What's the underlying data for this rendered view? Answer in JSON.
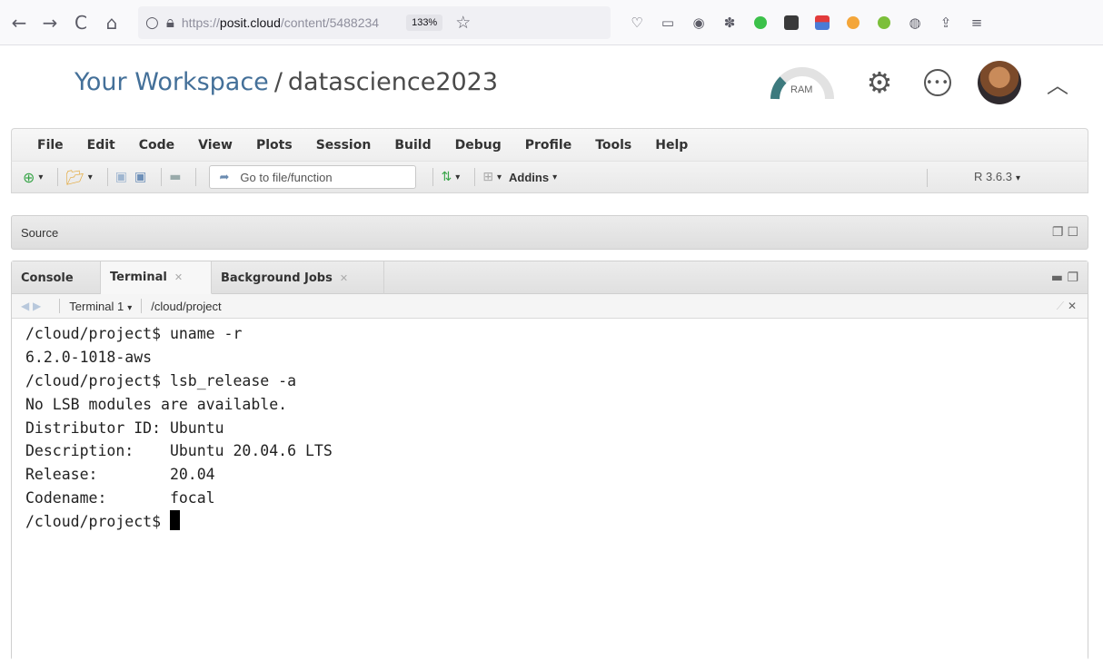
{
  "browser": {
    "back": "←",
    "forward": "→",
    "reload": "C",
    "home": "⌂",
    "url_prefix": "https://",
    "url_host": "posit.cloud",
    "url_path": "/content/5488234",
    "zoom": "133%"
  },
  "header": {
    "workspace_link": "Your Workspace",
    "separator": "/",
    "project_name": "datascience2023",
    "ram_label": "RAM"
  },
  "menu": [
    "File",
    "Edit",
    "Code",
    "View",
    "Plots",
    "Session",
    "Build",
    "Debug",
    "Profile",
    "Tools",
    "Help"
  ],
  "toolbar": {
    "goto_placeholder": "Go to file/function",
    "addins": "Addins",
    "r_version": "R 3.6.3"
  },
  "source_pane": {
    "label": "Source"
  },
  "console_pane": {
    "tabs": [
      "Console",
      "Terminal",
      "Background Jobs"
    ],
    "terminal_selector": "Terminal 1",
    "working_dir": "/cloud/project"
  },
  "terminal_lines": [
    "/cloud/project$ uname -r",
    "6.2.0-1018-aws",
    "/cloud/project$ lsb_release -a",
    "No LSB modules are available.",
    "Distributor ID: Ubuntu",
    "Description:    Ubuntu 20.04.6 LTS",
    "Release:        20.04",
    "Codename:       focal",
    "/cloud/project$ "
  ]
}
